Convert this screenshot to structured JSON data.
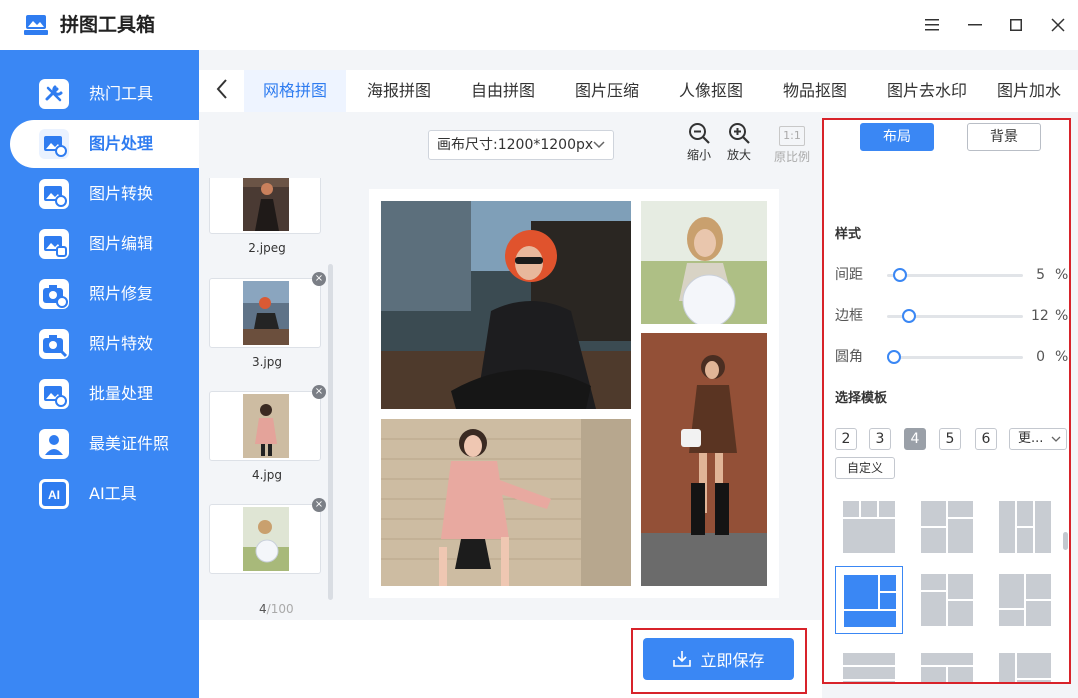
{
  "app": {
    "title": "拼图工具箱"
  },
  "sidebar": {
    "items": [
      {
        "label": "热门工具"
      },
      {
        "label": "图片处理"
      },
      {
        "label": "图片转换"
      },
      {
        "label": "图片编辑"
      },
      {
        "label": "照片修复"
      },
      {
        "label": "照片特效"
      },
      {
        "label": "批量处理"
      },
      {
        "label": "最美证件照"
      },
      {
        "label": "AI工具"
      }
    ],
    "active_index": 1
  },
  "tabs": {
    "items": [
      {
        "label": "网格拼图"
      },
      {
        "label": "海报拼图"
      },
      {
        "label": "自由拼图"
      },
      {
        "label": "图片压缩"
      },
      {
        "label": "人像抠图"
      },
      {
        "label": "物品抠图"
      },
      {
        "label": "图片去水印"
      },
      {
        "label": "图片加水"
      }
    ],
    "active_index": 0
  },
  "toolbar": {
    "canvas_size": "画布尺寸:1200*1200px",
    "zoom_out": "缩小",
    "zoom_in": "放大",
    "ratio_icon": "1:1",
    "original_ratio": "原比例"
  },
  "thumbnails": {
    "items": [
      {
        "name": "2.jpeg"
      },
      {
        "name": "3.jpg"
      },
      {
        "name": "4.jpg"
      },
      {
        "name": ""
      }
    ],
    "count_current": "4",
    "count_separator": "/",
    "count_max": "100"
  },
  "save": {
    "label": "立即保存"
  },
  "panel": {
    "tab_layout": "布局",
    "tab_background": "背景",
    "style_heading": "样式",
    "sliders": [
      {
        "label": "间距",
        "value": 5,
        "unit": "%",
        "fraction": 0.05
      },
      {
        "label": "边框",
        "value": 12,
        "unit": "%",
        "fraction": 0.12
      },
      {
        "label": "圆角",
        "value": 0,
        "unit": "%",
        "fraction": 0.0
      }
    ],
    "template_heading": "选择模板",
    "counts": [
      "2",
      "3",
      "4",
      "5",
      "6"
    ],
    "active_count": "4",
    "more": "更...",
    "custom": "自定义"
  },
  "colors": {
    "accent": "#3a87f4",
    "highlight_frame": "#d8232a",
    "template_gray": "#c8ccd2"
  }
}
